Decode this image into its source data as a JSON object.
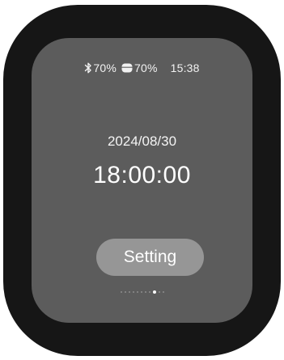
{
  "status_bar": {
    "bluetooth_icon": "bluetooth-icon",
    "bluetooth_battery": "70%",
    "earbuds_icon": "earbuds-case-icon",
    "earbuds_battery": "70%",
    "time": "15:38"
  },
  "main": {
    "date": "2024/08/30",
    "time": "18:00:00",
    "setting_label": "Setting"
  },
  "pagination": {
    "total_pages": 11,
    "active_index": 8
  },
  "colors": {
    "device_frame": "#161616",
    "screen_bg": "#5c5c5c",
    "button_bg": "#969696",
    "text": "#ffffff"
  }
}
